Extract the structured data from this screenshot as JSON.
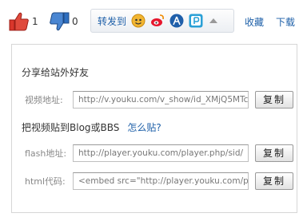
{
  "toolbar": {
    "like_count": "1",
    "dislike_count": "0",
    "share_label": "转发到",
    "share_sites": [
      {
        "icon": "qzone-icon",
        "color": "#e8a21c"
      },
      {
        "icon": "weibo-icon",
        "color": "#e6162d"
      },
      {
        "icon": "renren-icon",
        "color": "#1f5faa"
      },
      {
        "icon": "kaixin-icon",
        "color": "#2aa0d6"
      }
    ],
    "favorite_label": "收藏",
    "download_label": "下载"
  },
  "share_panel": {
    "title": "分享给站外好友",
    "video_url": {
      "label": "视频地址:",
      "value": "http://v.youku.com/v_show/id_XMjQ5MTc",
      "button": "复制"
    },
    "blog_section": {
      "title": "把视频贴到Blog或BBS",
      "help_link": "怎么贴?"
    },
    "flash_url": {
      "label": "flash地址:",
      "value": "http://player.youku.com/player.php/sid/",
      "button": "复制"
    },
    "html_code": {
      "label": "html代码:",
      "value": "<embed src=\"http://player.youku.com/p",
      "button": "复制"
    }
  }
}
